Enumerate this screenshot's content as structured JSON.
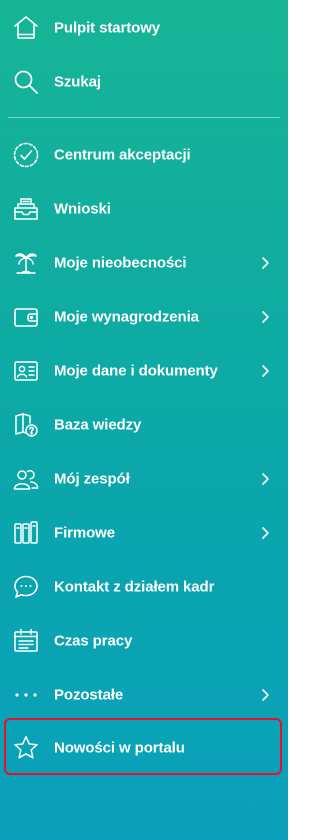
{
  "menu": {
    "items": [
      {
        "label": "Pulpit startowy",
        "icon": "home-icon",
        "has_submenu": false
      },
      {
        "label": "Szukaj",
        "icon": "search-icon",
        "has_submenu": false
      },
      {
        "label": "Centrum akceptacji",
        "icon": "check-circle-icon",
        "has_submenu": false
      },
      {
        "label": "Wnioski",
        "icon": "inbox-tray-icon",
        "has_submenu": false
      },
      {
        "label": "Moje nieobecności",
        "icon": "palm-tree-icon",
        "has_submenu": true
      },
      {
        "label": "Moje wynagrodzenia",
        "icon": "wallet-icon",
        "has_submenu": true
      },
      {
        "label": "Moje dane i dokumenty",
        "icon": "id-card-icon",
        "has_submenu": true
      },
      {
        "label": "Baza wiedzy",
        "icon": "book-question-icon",
        "has_submenu": false
      },
      {
        "label": "Mój zespół",
        "icon": "team-icon",
        "has_submenu": true
      },
      {
        "label": "Firmowe",
        "icon": "binders-icon",
        "has_submenu": true
      },
      {
        "label": "Kontakt z działem kadr",
        "icon": "chat-bubble-icon",
        "has_submenu": false
      },
      {
        "label": "Czas pracy",
        "icon": "calendar-list-icon",
        "has_submenu": false
      },
      {
        "label": "Pozostałe",
        "icon": "more-dots-icon",
        "has_submenu": true
      },
      {
        "label": "Nowości w portalu",
        "icon": "star-icon",
        "has_submenu": false,
        "highlighted": true
      }
    ]
  },
  "colors": {
    "gradient_top": "#17b596",
    "gradient_bottom": "#0aa0bb",
    "text": "#ffffff",
    "highlight_border": "#e8102e"
  }
}
